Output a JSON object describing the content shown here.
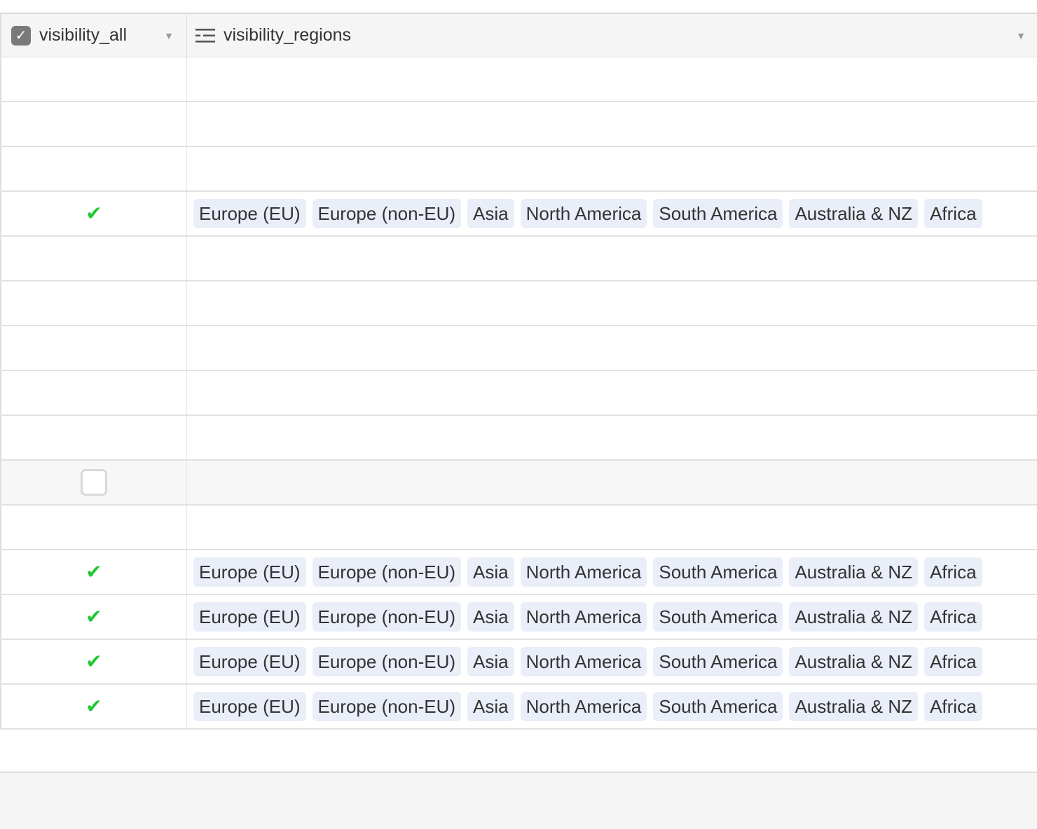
{
  "columns": [
    {
      "label": "visibility_all",
      "icon": "checkbox-field-icon"
    },
    {
      "label": "visibility_regions",
      "icon": "multiple-select-field-icon"
    }
  ],
  "regions": [
    "Europe (EU)",
    "Europe (non-EU)",
    "Asia",
    "North America",
    "South America",
    "Australia & NZ",
    "Africa"
  ],
  "rows": [
    {
      "state": "blank",
      "regions": false
    },
    {
      "state": "blank",
      "regions": false
    },
    {
      "state": "blank",
      "regions": false
    },
    {
      "state": "checked",
      "regions": true
    },
    {
      "state": "blank",
      "regions": false
    },
    {
      "state": "blank",
      "regions": false
    },
    {
      "state": "blank",
      "regions": false
    },
    {
      "state": "blank",
      "regions": false
    },
    {
      "state": "blank",
      "regions": false
    },
    {
      "state": "empty-box",
      "regions": false,
      "hover": true
    },
    {
      "state": "blank",
      "regions": false
    },
    {
      "state": "checked",
      "regions": true
    },
    {
      "state": "checked",
      "regions": true
    },
    {
      "state": "checked",
      "regions": true
    },
    {
      "state": "checked",
      "regions": true
    }
  ],
  "colors": {
    "check": "#20c933",
    "pill": "#e9eef9",
    "header_bg": "#f5f5f5"
  }
}
